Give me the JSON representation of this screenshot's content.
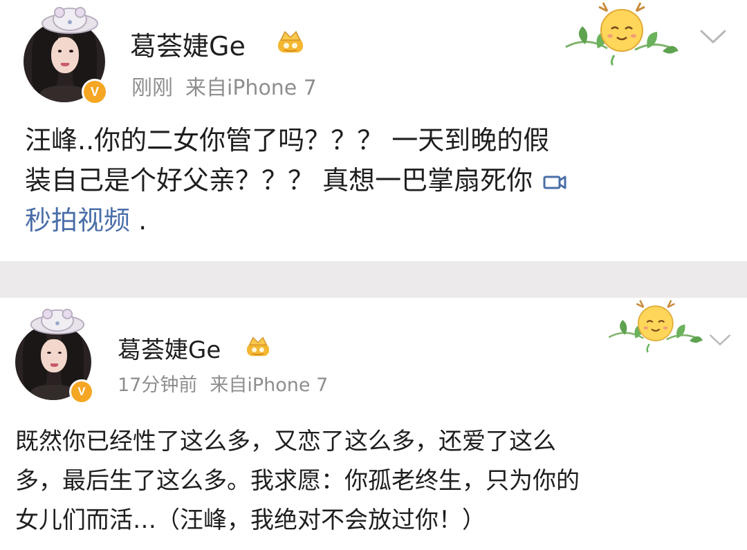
{
  "posts": [
    {
      "username": "葛荟婕Ge",
      "timestamp": "刚刚",
      "source": "来自iPhone 7",
      "text_lines": [
        "汪峰..你的二女你管了吗？？？ 一天到晚的假",
        "装自己是个好父亲？？？ 真想一巴掌扇死你"
      ],
      "video_link": "秒拍视频",
      "trailing": " ."
    },
    {
      "username": "葛荟婕Ge",
      "timestamp": "17分钟前",
      "source": "来自iPhone 7",
      "text_lines": [
        "既然你已经性了这么多，又恋了这么多，还爱了这么",
        "多，最后生了这么多。我求愿：你孤老终生，只为你的",
        "女儿们而活…（汪峰，我绝对不会放过你！）"
      ]
    }
  ],
  "colors": {
    "accent_link": "#4a6ea8",
    "meta_gray": "#8e8e8e",
    "verify_gold": "#f5a623",
    "separator": "#eceaeb"
  },
  "icons": {
    "verified": "verified-v-badge-icon",
    "crown": "vip-crown-icon",
    "mascot": "deer-mascot-sticker-icon",
    "menu": "chevron-down-icon",
    "video": "video-icon"
  }
}
